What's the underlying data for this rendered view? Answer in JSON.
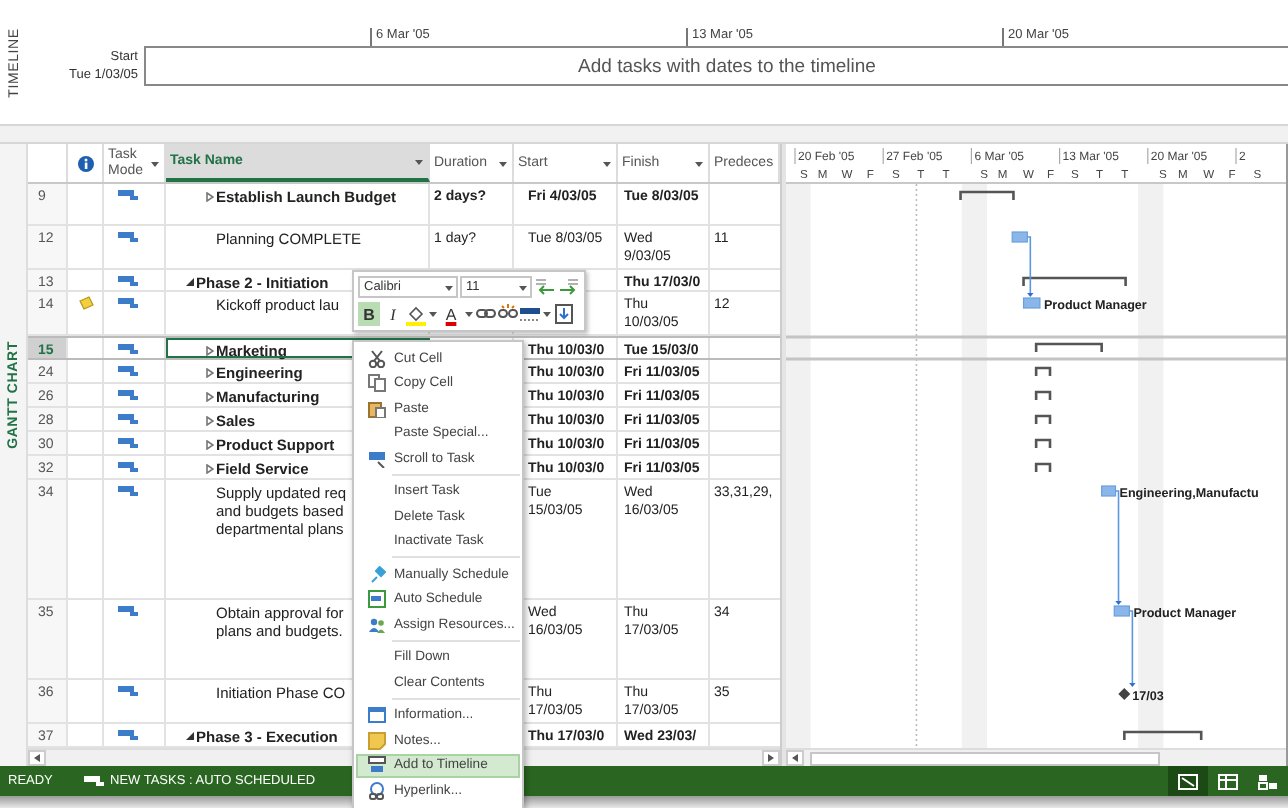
{
  "timeline": {
    "title": "TIMELINE",
    "start_label": "Start",
    "start_date": "Tue 1/03/05",
    "ticks": [
      "6 Mar '05",
      "13 Mar '05",
      "20 Mar '05"
    ],
    "hint": "Add tasks with dates to the timeline"
  },
  "view_title": "GANTT CHART",
  "columns": [
    {
      "kind": "id"
    },
    {
      "kind": "info"
    },
    {
      "kind": "text",
      "label": "Task Mode",
      "dropdown": true,
      "selected": false
    },
    {
      "kind": "text",
      "label": "Task Name",
      "dropdown": true,
      "selected": true
    },
    {
      "kind": "text",
      "label": "Duration",
      "dropdown": true,
      "selected": false
    },
    {
      "kind": "text",
      "label": "Start",
      "dropdown": true,
      "selected": false
    },
    {
      "kind": "text",
      "label": "Finish",
      "dropdown": true,
      "selected": false
    },
    {
      "kind": "text",
      "label": "Predeces",
      "dropdown": false,
      "selected": false
    }
  ],
  "rows": [
    {
      "kind": "offscreen_parent",
      "children": [
        {
          "id": "9",
          "kind": "summary_collapsed",
          "name": "Establish Launch Budget",
          "duration": "2 days?",
          "start": "Fri 4/03/05",
          "finish": "Tue 8/03/05",
          "note": false,
          "selected": false
        },
        {
          "id": "12",
          "kind": "task",
          "name": "Planning COMPLETE",
          "duration": "1 day?",
          "start": "Tue 8/03/05",
          "finish": "Wed 9/03/05",
          "predecessors": "11",
          "note": false,
          "selected": false
        }
      ]
    },
    {
      "id": "13",
      "kind": "summary_expanded",
      "name": "Phase 2 - Initiation",
      "finish": "Thu 17/03/0",
      "note": false,
      "selected": false,
      "children": [
        {
          "id": "14",
          "kind": "task",
          "name": "Kickoff product lau",
          "finish": "Thu 10/03/05",
          "predecessors": "12",
          "resource": "Product Manager",
          "note": true,
          "selected": false
        },
        {
          "id": "15",
          "kind": "summary_collapsed",
          "name": "Marketing",
          "start": "Thu 10/03/0",
          "finish": "Tue 15/03/0",
          "note": false,
          "selected": true
        },
        {
          "id": "24",
          "kind": "summary_collapsed",
          "name": "Engineering",
          "start": "Thu 10/03/0",
          "finish": "Fri 11/03/05",
          "note": false,
          "selected": false
        },
        {
          "id": "26",
          "kind": "summary_collapsed",
          "name": "Manufacturing",
          "start": "Thu 10/03/0",
          "finish": "Fri 11/03/05",
          "note": false,
          "selected": false
        },
        {
          "id": "28",
          "kind": "summary_collapsed",
          "name": "Sales",
          "start": "Thu 10/03/0",
          "finish": "Fri 11/03/05",
          "note": false,
          "selected": false
        },
        {
          "id": "30",
          "kind": "summary_collapsed",
          "name": "Product Support",
          "start": "Thu 10/03/0",
          "finish": "Fri 11/03/05",
          "note": false,
          "selected": false
        },
        {
          "id": "32",
          "kind": "summary_collapsed",
          "name": "Field Service",
          "start": "Thu 10/03/0",
          "finish": "Fri 11/03/05",
          "note": false,
          "selected": false
        },
        {
          "id": "34",
          "kind": "task",
          "name": "Supply updated req\nand budgets based\ndepartmental plans",
          "start": "Tue 15/03/05",
          "finish": "Wed 16/03/05",
          "predecessors": "33,31,29,",
          "resource": "Engineering,Manufactu",
          "note": false,
          "selected": false
        },
        {
          "id": "35",
          "kind": "task",
          "name": "Obtain approval for\nplans and budgets.",
          "start": "Wed 16/03/05",
          "finish": "Thu 17/03/05",
          "predecessors": "34",
          "resource": "Product Manager",
          "note": false,
          "selected": false
        },
        {
          "id": "36",
          "kind": "milestone",
          "name": "Initiation Phase CO",
          "start": "Thu 17/03/05",
          "finish": "Thu 17/03/05",
          "predecessors": "35",
          "resource": "17/03",
          "note": false,
          "selected": false
        }
      ]
    },
    {
      "id": "37",
      "kind": "summary_expanded",
      "name": "Phase 3 - Execution",
      "start": "Thu 17/03/0",
      "finish": "Wed 23/03/",
      "note": false,
      "selected": false
    }
  ],
  "gantt": {
    "weeks": [
      "20 Feb '05",
      "27 Feb '05",
      "6 Mar '05",
      "13 Mar '05",
      "20 Mar '05",
      "2"
    ],
    "days": [
      "S",
      "M",
      "W",
      "F",
      "S",
      "T",
      "T",
      "S",
      "M",
      "W",
      "F",
      "S",
      "T",
      "T",
      "S",
      "M",
      "W",
      "F",
      "S"
    ]
  },
  "mini_toolbar": {
    "font": "Calibri",
    "size": "11",
    "buttons": [
      {
        "kind": "bold",
        "label": "B",
        "on": true
      },
      {
        "kind": "italic",
        "label": "I",
        "on": false
      },
      {
        "kind": "fill_color"
      },
      {
        "kind": "font_color",
        "label": "A"
      },
      {
        "kind": "link"
      },
      {
        "kind": "unlink"
      },
      {
        "kind": "bar_style"
      },
      {
        "kind": "schedule"
      }
    ]
  },
  "context_menu": [
    [
      {
        "label": "Cut Cell",
        "selected": false
      },
      {
        "label": "Copy Cell",
        "selected": false
      },
      {
        "label": "Paste",
        "selected": false
      },
      {
        "label": "Paste Special...",
        "selected": false
      },
      {
        "label": "Scroll to Task",
        "selected": false
      }
    ],
    [
      {
        "label": "Insert Task",
        "selected": false
      },
      {
        "label": "Delete Task",
        "selected": false
      },
      {
        "label": "Inactivate Task",
        "selected": false
      }
    ],
    [
      {
        "label": "Manually Schedule",
        "selected": false
      },
      {
        "label": "Auto Schedule",
        "selected": false
      },
      {
        "label": "Assign Resources...",
        "selected": false
      }
    ],
    [
      {
        "label": "Fill Down",
        "selected": false
      },
      {
        "label": "Clear Contents",
        "selected": false
      }
    ],
    [
      {
        "label": "Information...",
        "selected": false
      },
      {
        "label": "Notes...",
        "selected": false
      },
      {
        "label": "Add to Timeline",
        "selected": true
      },
      {
        "label": "Hyperlink...",
        "selected": false
      }
    ]
  ],
  "status_bar": {
    "mode": "READY",
    "new_tasks": "NEW TASKS : AUTO SCHEDULED",
    "views": [
      {
        "selected": true
      },
      {
        "selected": false
      },
      {
        "selected": false
      }
    ]
  }
}
